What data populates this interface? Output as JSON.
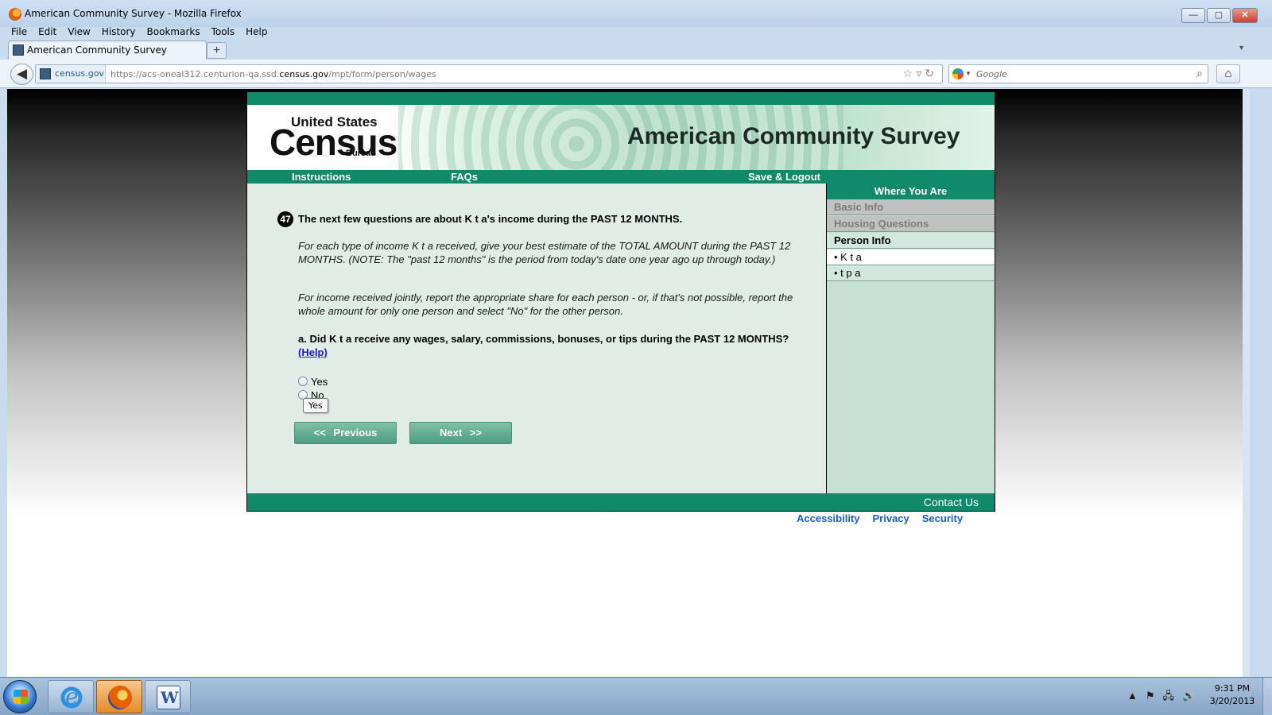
{
  "window": {
    "title": "American Community Survey - Mozilla Firefox",
    "minimize": "—",
    "maximize": "▢",
    "close": "✕"
  },
  "menu": [
    "File",
    "Edit",
    "View",
    "History",
    "Bookmarks",
    "Tools",
    "Help"
  ],
  "tab": {
    "label": "American Community Survey",
    "new_tab": "+"
  },
  "nav": {
    "identity": "census.gov",
    "url_prefix": "https://acs-oneal312.centurion-qa.ssd.",
    "url_domain": "census.gov",
    "url_suffix": "/mpt/form/person/wages",
    "search_placeholder": "Google"
  },
  "site": {
    "logo_top": "United States",
    "logo_main": "Census",
    "logo_bottom": "Bureau",
    "title": "American Community Survey",
    "nav": {
      "instructions": "Instructions",
      "faqs": "FAQs",
      "save_logout": "Save & Logout"
    }
  },
  "question": {
    "number": "47",
    "heading": "The next few questions are about K t a's income during the PAST 12 MONTHS.",
    "para1": "For each type of income K t a received, give your best estimate of the TOTAL AMOUNT during the PAST 12 MONTHS. (NOTE: The \"past 12 months\" is the period from today's date one year ago up through today.)",
    "para2": "For income received jointly, report the appropriate share for each person - or, if that's not possible, report the whole amount for only one person and select \"No\" for the other person.",
    "sub": "a. Did K t a receive any wages, salary, commissions, bonuses, or tips during the PAST 12 MONTHS?",
    "help": "(Help)",
    "options": [
      "Yes",
      "No"
    ],
    "tooltip": "Yes",
    "prev": "<< Previous",
    "next": "Next >>"
  },
  "sidebar": {
    "heading": "Where You Are",
    "items": [
      {
        "label": "Basic Info"
      },
      {
        "label": "Housing Questions"
      },
      {
        "label": "Person Info"
      },
      {
        "label": "• K t a"
      },
      {
        "label": "• t p a"
      }
    ]
  },
  "footer": {
    "contact": "Contact Us",
    "links": [
      "Accessibility",
      "Privacy",
      "Security"
    ]
  },
  "taskbar": {
    "time": "9:31 PM",
    "date": "3/20/2013",
    "tray_icons": [
      "▲",
      "⚑",
      "🖧",
      "🔊"
    ]
  }
}
